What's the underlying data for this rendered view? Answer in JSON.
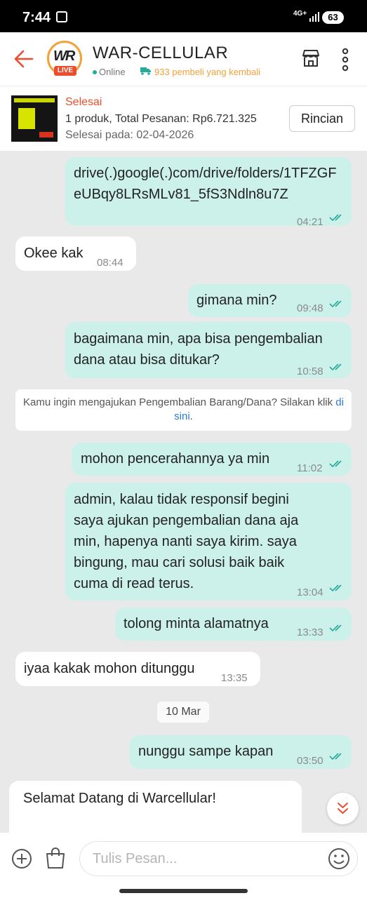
{
  "status_bar": {
    "time": "7:44",
    "network": "4G+",
    "battery": "63"
  },
  "header": {
    "shop_name": "WAR-CELLULAR",
    "logo_text": "WR",
    "live_badge": "LIVE",
    "online": "Online",
    "buyers": "933 pembeli yang kembali"
  },
  "order": {
    "status": "Selesai",
    "summary": "1 produk, Total Pesanan: Rp6.721.325",
    "completed": "Selesai pada: 02-04-2026",
    "details_button": "Rincian"
  },
  "messages": [
    {
      "text": "drive(.)google(.)com/drive/folders/1TFZGFeUBqy8LRsMLv81_5fS3Ndln8u7Z",
      "time": "04:21",
      "sender": "me"
    },
    {
      "text": "Okee kak",
      "time": "08:44",
      "sender": "shop"
    },
    {
      "text": "gimana min?",
      "time": "09:48",
      "sender": "me"
    },
    {
      "text": "bagaimana min, apa bisa pengembalian dana atau bisa ditukar?",
      "time": "10:58",
      "sender": "me"
    },
    {
      "text": "mohon pencerahannya ya min",
      "time": "11:02",
      "sender": "me"
    },
    {
      "text": "admin, kalau tidak responsif begini saya ajukan pengembalian dana aja min, hapenya nanti saya kirim. saya bingung, mau cari solusi baik baik cuma di read terus.",
      "time": "13:04",
      "sender": "me"
    },
    {
      "text": "tolong minta alamatnya",
      "time": "13:33",
      "sender": "me"
    },
    {
      "text": "iyaa kakak mohon ditunggu",
      "time": "13:35",
      "sender": "shop"
    },
    {
      "text": "nunggu sampe kapan",
      "time": "03:50",
      "sender": "me"
    },
    {
      "text": "Selamat Datang di Warcellular!",
      "time": "",
      "sender": "shop"
    }
  ],
  "notice": {
    "text": "Kamu ingin mengajukan Pengembalian Barang/Dana? Silakan klik",
    "link": "di sini",
    "end": "."
  },
  "date_divider": "10 Mar",
  "input": {
    "placeholder": "Tulis Pesan..."
  },
  "colors": {
    "accent": "#ee4d2d",
    "outgoing_bubble": "#ccf1ea",
    "incoming_bubble": "#ffffff",
    "read_check": "#26aa99"
  }
}
